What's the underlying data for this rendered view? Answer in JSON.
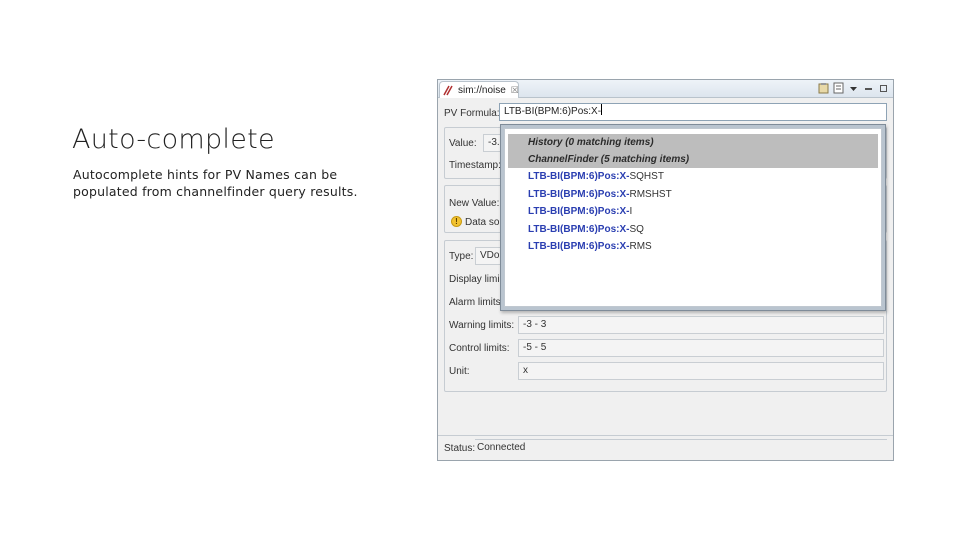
{
  "slide": {
    "title": "Auto-complete",
    "body": "Autocomplete hints for PV Names can be populated from channelfinder query results."
  },
  "window": {
    "tab_label": "sim://noise",
    "tab_close": "☒",
    "formula_label": "PV Formula:",
    "formula_value": "LTB-BI(BPM:6)Pos:X-",
    "value_label": "Value:",
    "value_partial": "-3.5",
    "timestamp_label": "Timestamp:",
    "new_value_label": "New Value:",
    "data_source_partial": "Data sou",
    "type_label": "Type:",
    "type_partial": "VDou",
    "display_limits_partial": "Display limi",
    "alarm_limits_partial": "Alarm limits",
    "warning_limits_label": "Warning limits:",
    "warning_limits_value": "-3 - 3",
    "control_limits_label": "Control limits:",
    "control_limits_value": "-5 - 5",
    "unit_label": "Unit:",
    "unit_value": "x",
    "status_label": "Status:",
    "status_value": "Connected"
  },
  "autocomplete": {
    "headers": [
      "History (0 matching items)",
      "ChannelFinder (5 matching items)"
    ],
    "items": [
      {
        "match": "LTB-BI(BPM:6)Pos:X-",
        "rest": "SQHST"
      },
      {
        "match": "LTB-BI(BPM:6)Pos:X-",
        "rest": "RMSHST"
      },
      {
        "match": "LTB-BI(BPM:6)Pos:X-",
        "rest": "I"
      },
      {
        "match": "LTB-BI(BPM:6)Pos:X-",
        "rest": "SQ"
      },
      {
        "match": "LTB-BI(BPM:6)Pos:X-",
        "rest": "RMS"
      }
    ]
  },
  "colors": {
    "match_text": "#2a3eb1",
    "header_bg": "#bdbdbd",
    "warning": "#f2c230"
  }
}
